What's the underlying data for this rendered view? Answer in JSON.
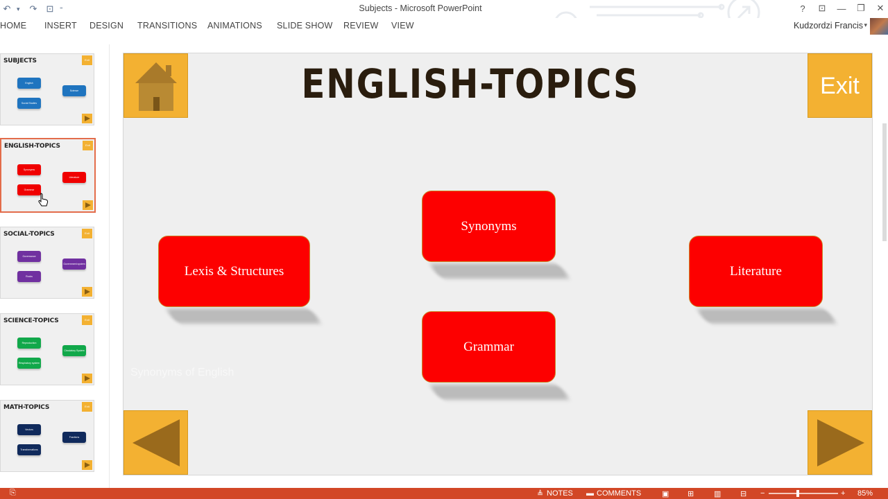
{
  "window": {
    "title": "Subjects - Microsoft PowerPoint",
    "help": "?",
    "ribbon_display": "⊡",
    "minimize": "—",
    "restore": "❐",
    "close": "✕"
  },
  "qat": {
    "undo": "↶",
    "dropdown": "▾",
    "redo": "↷",
    "start_from_beginning": "⊡",
    "customize": "⁼"
  },
  "ribbon": {
    "tabs": [
      "HOME",
      "INSERT",
      "DESIGN",
      "TRANSITIONS",
      "ANIMATIONS",
      "SLIDE SHOW",
      "REVIEW",
      "VIEW"
    ],
    "user": "Kudzordzi Francis"
  },
  "thumbnails": [
    {
      "title": "SUBJECTS",
      "buttons": [
        "English",
        "Science",
        "Social Studies"
      ],
      "color": "#1f74bf"
    },
    {
      "title": "ENGLISH-TOPICS",
      "buttons": [
        "Synonyms",
        "Literature",
        "Grammar"
      ],
      "color": "#f00000"
    },
    {
      "title": "SOCIAL-TOPICS",
      "buttons": [
        "Governance",
        "Government system",
        "Rocks"
      ],
      "color": "#7030a0"
    },
    {
      "title": "SCIENCE-TOPICS",
      "buttons": [
        "Reproduction",
        "Circulatory System",
        "Respiratory system"
      ],
      "color": "#11a84a"
    },
    {
      "title": "MATH-TOPICS",
      "buttons": [
        "Vectors",
        "Fractions",
        "Transformations"
      ],
      "color": "#102a5c"
    }
  ],
  "thumb_exit": "Exit",
  "slide": {
    "title": "ENGLISH-TOPICS",
    "exit_label": "Exit",
    "topics": {
      "lexis": "Lexis & Structures",
      "synonyms": "Synonyms",
      "grammar": "Grammar",
      "literature": "Literature"
    },
    "ghost_text": "Synonyms of English"
  },
  "status": {
    "notes": "NOTES",
    "comments": "COMMENTS",
    "zoom": "85%"
  },
  "colors": {
    "accent_orange": "#f3b132",
    "topic_red": "#fd0000",
    "status_bar": "#d24726",
    "selected_thumb_border": "#e36c4a"
  }
}
